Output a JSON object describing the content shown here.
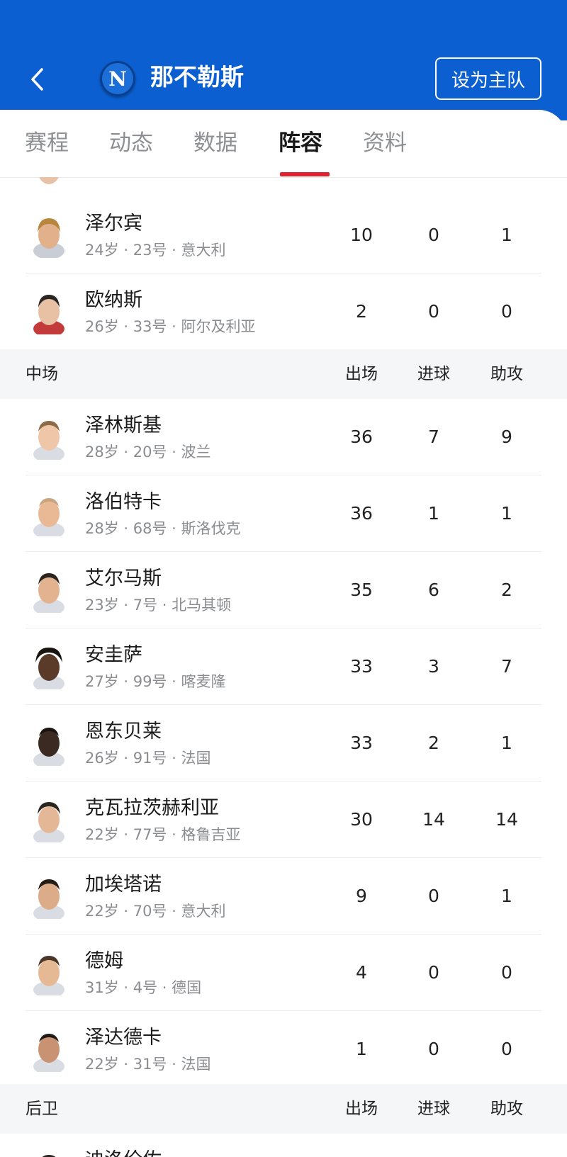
{
  "header": {
    "team_name": "那不勒斯",
    "logo_letter": "N",
    "set_home_label": "设为主队",
    "bg_color": "#0b5fd0"
  },
  "tabs": [
    {
      "label": "赛程"
    },
    {
      "label": "动态"
    },
    {
      "label": "数据"
    },
    {
      "label": "阵容",
      "active": true
    },
    {
      "label": "资料"
    }
  ],
  "columns": {
    "apps": "出场",
    "goals": "进球",
    "assists": "助攻"
  },
  "goalkeeper_rows": [
    {
      "name": "泽尔宾",
      "info": "24岁 · 23号 · 意大利",
      "apps": "10",
      "goals": "0",
      "assists": "1"
    },
    {
      "name": "欧纳斯",
      "info": "26岁 · 33号 · 阿尔及利亚",
      "apps": "2",
      "goals": "0",
      "assists": "0"
    }
  ],
  "midfield": {
    "label": "中场",
    "rows": [
      {
        "name": "泽林斯基",
        "info": "28岁 · 20号 · 波兰",
        "apps": "36",
        "goals": "7",
        "assists": "9"
      },
      {
        "name": "洛伯特卡",
        "info": "28岁 · 68号 · 斯洛伐克",
        "apps": "36",
        "goals": "1",
        "assists": "1"
      },
      {
        "name": "艾尔马斯",
        "info": "23岁 · 7号 · 北马其顿",
        "apps": "35",
        "goals": "6",
        "assists": "2"
      },
      {
        "name": "安圭萨",
        "info": "27岁 · 99号 · 喀麦隆",
        "apps": "33",
        "goals": "3",
        "assists": "7"
      },
      {
        "name": "恩东贝莱",
        "info": "26岁 · 91号 · 法国",
        "apps": "33",
        "goals": "2",
        "assists": "1"
      },
      {
        "name": "克瓦拉茨赫利亚",
        "info": "22岁 · 77号 · 格鲁吉亚",
        "apps": "30",
        "goals": "14",
        "assists": "14"
      },
      {
        "name": "加埃塔诺",
        "info": "22岁 · 70号 · 意大利",
        "apps": "9",
        "goals": "0",
        "assists": "1"
      },
      {
        "name": "德姆",
        "info": "31岁 · 4号 · 德国",
        "apps": "4",
        "goals": "0",
        "assists": "0"
      },
      {
        "name": "泽达德卡",
        "info": "22岁 · 31号 · 法国",
        "apps": "1",
        "goals": "0",
        "assists": "0"
      }
    ]
  },
  "defense": {
    "label": "后卫",
    "first_row_name_partial": "迪洛伦佐"
  }
}
